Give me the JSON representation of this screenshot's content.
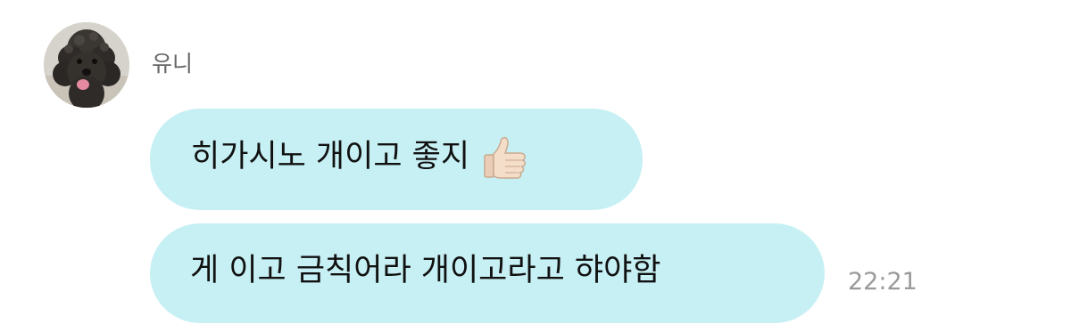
{
  "sender": {
    "name": "유니",
    "avatar_icon": "poodle-avatar-icon"
  },
  "messages": [
    {
      "text": "히가시노 개이고 좋지",
      "emoji_icon": "thumbs-up-icon"
    },
    {
      "text": "게 이고 금칙어라 개이고라고 햐야함"
    }
  ],
  "timestamp": "22:21",
  "colors": {
    "bubble": "#c7f0f4",
    "sender_name": "#666666",
    "timestamp": "#9a9a9a",
    "text": "#111111"
  }
}
